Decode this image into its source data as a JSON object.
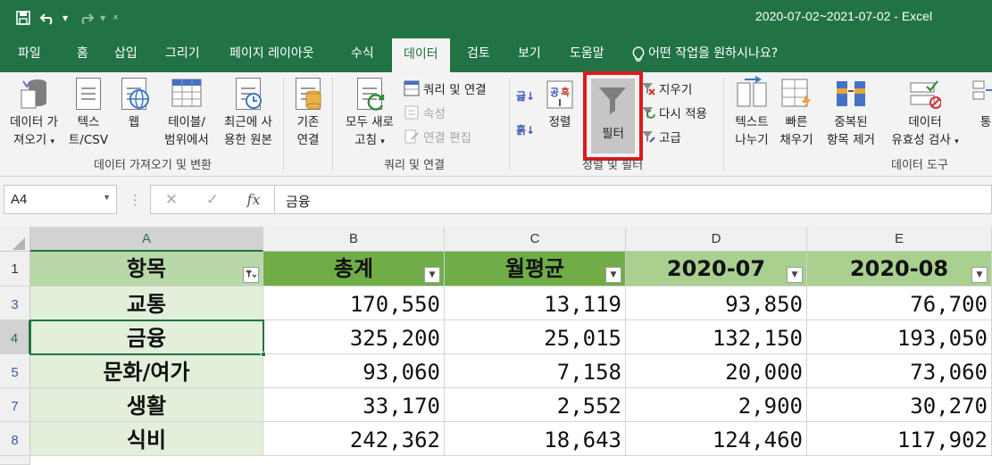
{
  "window": {
    "title": "2020-07-02~2021-07-02  -  Excel"
  },
  "qat": {
    "save_icon": "save-icon",
    "undo_icon": "undo-icon",
    "redo_icon": "redo-icon"
  },
  "tabs": [
    {
      "label": "파일"
    },
    {
      "label": "홈"
    },
    {
      "label": "삽입"
    },
    {
      "label": "그리기"
    },
    {
      "label": "페이지 레이아웃"
    },
    {
      "label": "수식"
    },
    {
      "label": "데이터",
      "active": true
    },
    {
      "label": "검토"
    },
    {
      "label": "보기"
    },
    {
      "label": "도움말"
    }
  ],
  "tell_me": "어떤 작업을 원하시나요?",
  "ribbon": {
    "groups": {
      "get_data": "데이터 가져오기 및 변환",
      "queries": "쿼리 및 연결",
      "sort_filter": "정렬 및 필터",
      "data_tools": "데이터 도구"
    },
    "get_data": {
      "l1": "데이터 가",
      "l2": "져오기"
    },
    "text_csv": {
      "l1": "텍스",
      "l2": "트/CSV"
    },
    "web": {
      "l1": "웹"
    },
    "table_range": {
      "l1": "테이블/",
      "l2": "범위에서"
    },
    "recent": {
      "l1": "최근에 사",
      "l2": "용한 원본"
    },
    "existing": {
      "l1": "기존",
      "l2": "연결"
    },
    "refresh_all": {
      "l1": "모두 새로",
      "l2": "고침"
    },
    "queries_connections": "쿼리 및 연결",
    "properties": "속성",
    "edit_links": "연결 편집",
    "sort": "정렬",
    "filter": "필터",
    "clear": "지우기",
    "reapply": "다시 적용",
    "advanced": "고급",
    "text_to_columns": {
      "l1": "텍스트",
      "l2": "나누기"
    },
    "flash_fill": {
      "l1": "빠른",
      "l2": "채우기"
    },
    "remove_dup": {
      "l1": "중복된",
      "l2": "항목 제거"
    },
    "validation": {
      "l1": "데이터",
      "l2": "유효성 검사"
    },
    "consolidate": {
      "l1": "통"
    }
  },
  "formula_bar": {
    "name_box": "A4",
    "content": "금융"
  },
  "columns": [
    "A",
    "B",
    "C",
    "D",
    "E"
  ],
  "header_row": {
    "row_num": "1",
    "cells": [
      "항목",
      "총계",
      "월평균",
      "2020-07",
      "2020-08"
    ]
  },
  "rows": [
    {
      "row_num": "3",
      "cells": [
        "교통",
        "170,550",
        "13,119",
        "93,850",
        "76,700"
      ]
    },
    {
      "row_num": "4",
      "cells": [
        "금융",
        "325,200",
        "25,015",
        "132,150",
        "193,050"
      ]
    },
    {
      "row_num": "5",
      "cells": [
        "문화/여가",
        "93,060",
        "7,158",
        "20,000",
        "73,060"
      ]
    },
    {
      "row_num": "7",
      "cells": [
        "생활",
        "33,170",
        "2,552",
        "2,900",
        "30,270"
      ]
    },
    {
      "row_num": "8",
      "cells": [
        "식비",
        "242,362",
        "18,643",
        "124,460",
        "117,902"
      ]
    }
  ],
  "colors": {
    "brand": "#217346",
    "header_a": "#b9d8a7",
    "header_b": "#70ad47",
    "header_d": "#a9d08e",
    "col_a_fill": "#e2efda",
    "highlight": "#e0181e"
  }
}
